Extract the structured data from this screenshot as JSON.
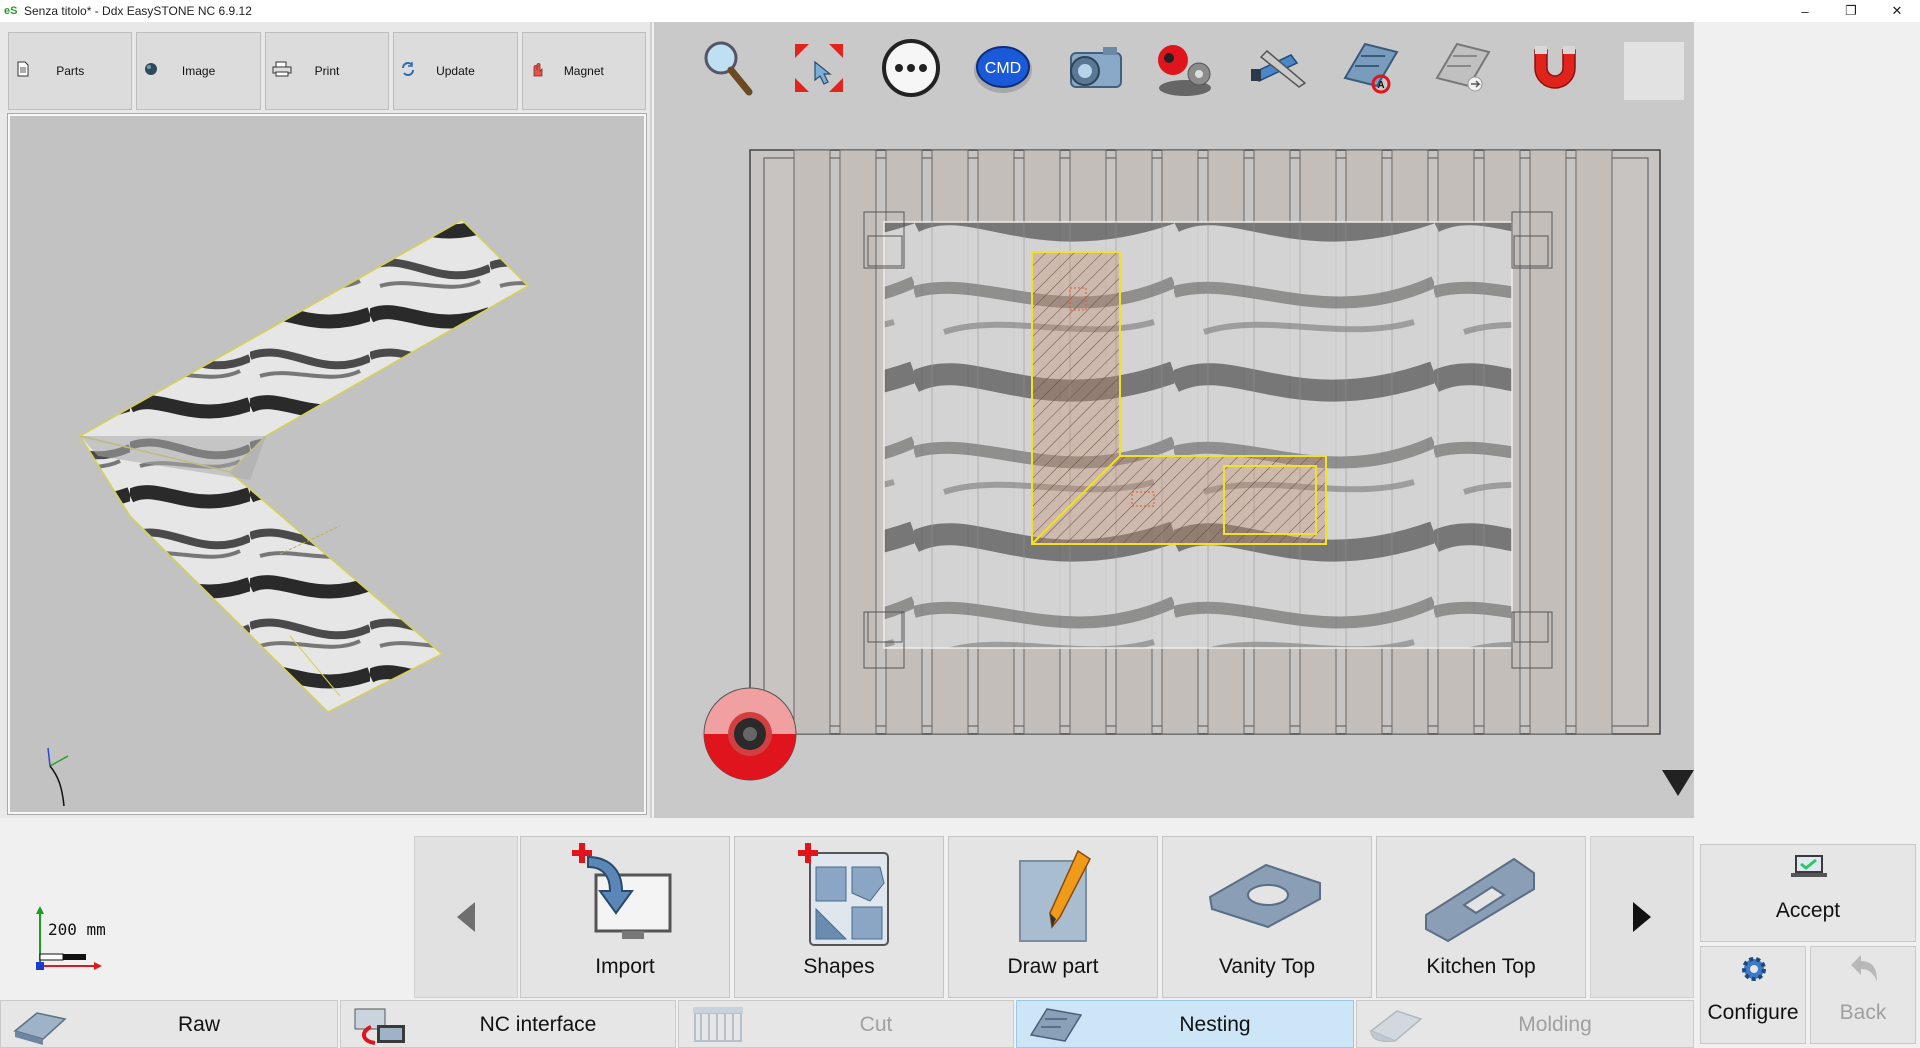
{
  "window": {
    "title": "Senza titolo* - Ddx EasySTONE NC 6.9.12",
    "app_icon": "easystone-icon",
    "minimize_glyph": "–",
    "maximize_glyph": "❐",
    "close_glyph": "✕"
  },
  "left_tabs": [
    {
      "label": "Parts",
      "icon": "document-icon"
    },
    {
      "label": "Image",
      "icon": "sphere-icon"
    },
    {
      "label": "Print",
      "icon": "printer-icon"
    },
    {
      "label": "Update",
      "icon": "refresh-icon"
    },
    {
      "label": "Magnet",
      "icon": "hand-icon"
    }
  ],
  "toolbar": [
    {
      "name": "zoom-tool-icon"
    },
    {
      "name": "fit-view-icon"
    },
    {
      "name": "more-options-icon"
    },
    {
      "name": "cmd-icon",
      "label": "CMD"
    },
    {
      "name": "camera-icon"
    },
    {
      "name": "laser-settings-icon"
    },
    {
      "name": "tools-icon"
    },
    {
      "name": "piece-origin-icon"
    },
    {
      "name": "piece-export-icon"
    },
    {
      "name": "magnet-tool-icon"
    }
  ],
  "scale": {
    "label": "200 mm"
  },
  "commands": [
    {
      "label": "Import",
      "icon": "import-icon"
    },
    {
      "label": "Shapes",
      "icon": "shapes-icon"
    },
    {
      "label": "Draw part",
      "icon": "draw-part-icon"
    },
    {
      "label": "Vanity Top",
      "icon": "vanity-top-icon"
    },
    {
      "label": "Kitchen Top",
      "icon": "kitchen-top-icon"
    }
  ],
  "side_actions": {
    "accept": "Accept",
    "configure": "Configure",
    "back": "Back"
  },
  "bottom_tabs": [
    {
      "label": "Raw",
      "state": "normal",
      "icon": "raw-slab-icon"
    },
    {
      "label": "NC interface",
      "state": "normal",
      "icon": "nc-interface-icon"
    },
    {
      "label": "Cut",
      "state": "disabled",
      "icon": "cut-icon"
    },
    {
      "label": "Nesting",
      "state": "active",
      "icon": "nesting-icon"
    },
    {
      "label": "Molding",
      "state": "disabled",
      "icon": "molding-icon"
    }
  ],
  "colors": {
    "accent_yellow": "#f2e02a",
    "red_cross": "#e0141c",
    "active_tab": "#cde6f7",
    "accept_green": "#2fc46a",
    "work_area_bg": "#c9c9c9"
  }
}
